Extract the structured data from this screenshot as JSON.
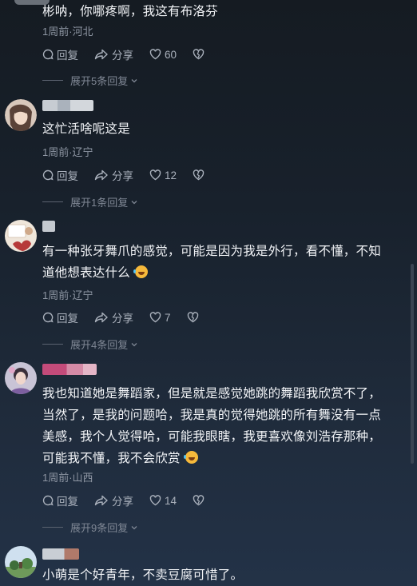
{
  "actions": {
    "reply": "回复",
    "share": "分享"
  },
  "comments": [
    {
      "content": "彬呐，你哪疼啊，我这有布洛芬",
      "meta": "1周前·河北",
      "likes": "60",
      "expand": "展开5条回复"
    },
    {
      "content": "这忙活啥呢这是",
      "meta": "1周前·辽宁",
      "likes": "12",
      "expand": "展开1条回复"
    },
    {
      "content_line1": "有一种张牙舞爪的感觉，可能是因为我是外行，看不懂，不知",
      "content_line2": "道他想表达什么",
      "meta": "1周前·辽宁",
      "likes": "7",
      "expand": "展开4条回复"
    },
    {
      "content_line1": "我也知道她是舞蹈家，但是就是感觉她跳的舞蹈我欣赏不了，",
      "content_line2": "当然了，是我的问题哈，我是真的觉得她跳的所有舞没有一点",
      "content_line3": "美感，我个人觉得哈，可能我眼瞎，我更喜欢像刘浩存那种，",
      "content_line4": "可能我不懂，我不会欣赏",
      "meta": "1周前·山西",
      "likes": "14",
      "expand": "展开9条回复"
    },
    {
      "content": "小萌是个好青年，不卖豆腐可惜了。"
    }
  ]
}
